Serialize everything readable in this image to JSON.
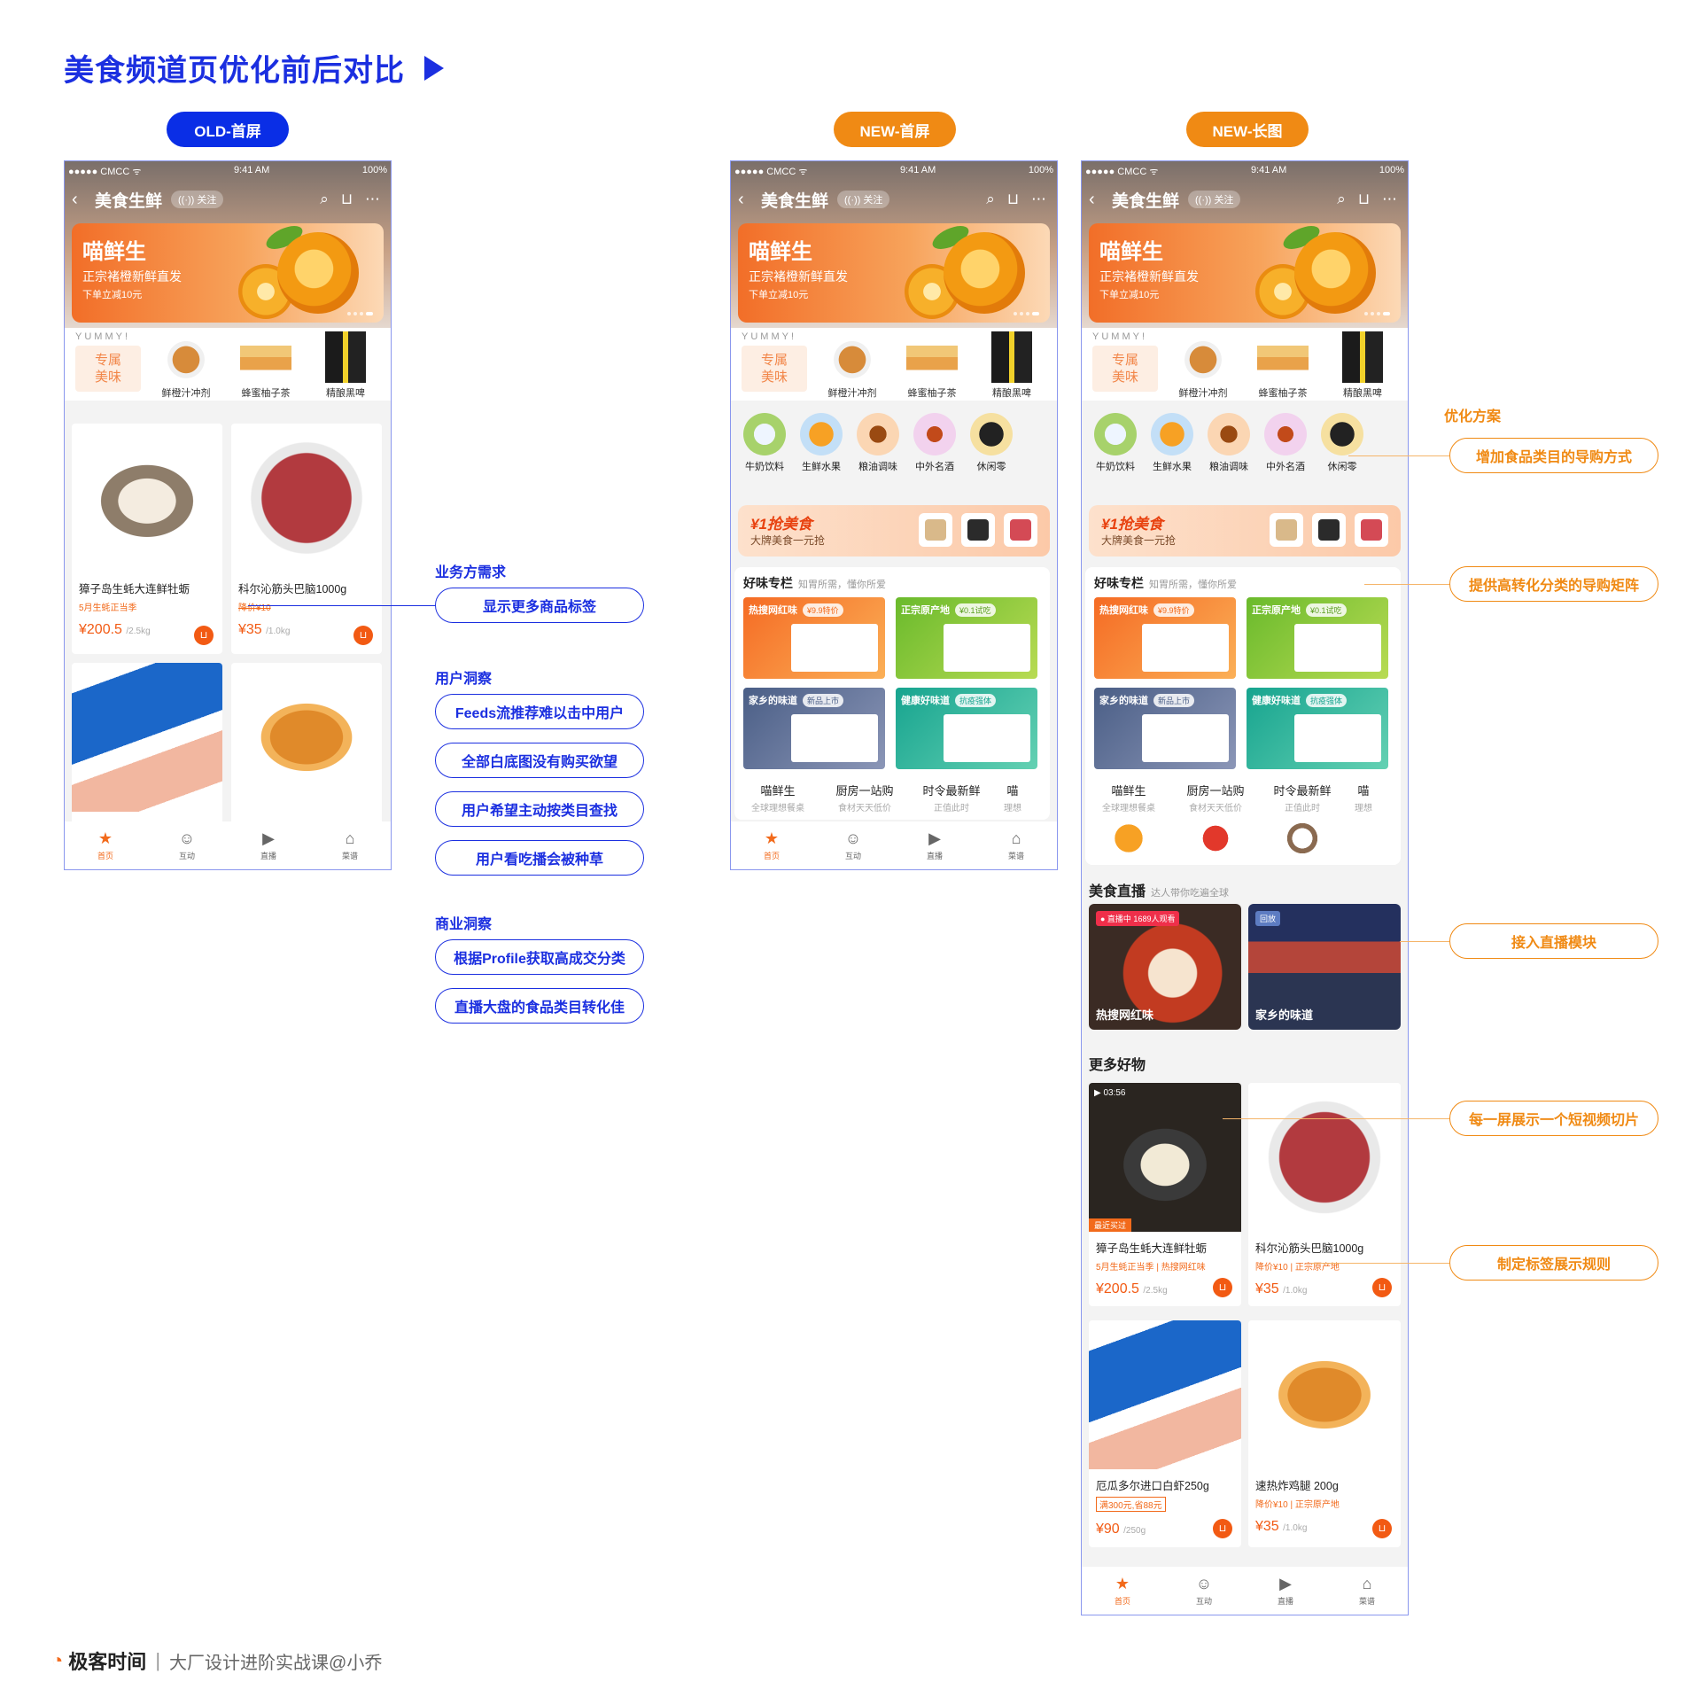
{
  "page": {
    "title": "美食频道页优化前后对比"
  },
  "labels": {
    "old": "OLD-首屏",
    "new_first": "NEW-首屏",
    "new_long": "NEW-长图"
  },
  "phone": {
    "status_left": "●●●●● CMCC ᯤ",
    "time": "9:41 AM",
    "battery": "100%",
    "back": "‹",
    "title": "美食生鲜",
    "follow": "((·)) 关注",
    "banner": {
      "title": "喵鲜生",
      "subtitle": "正宗褚橙新鲜直发",
      "promo": "下单立减10元"
    },
    "zone": {
      "yummy": "YUMMY!",
      "label": "专属\n美味",
      "items": [
        "鲜橙汁冲剂",
        "蜂蜜柚子茶",
        "精酿黑啤"
      ]
    },
    "categories": [
      "牛奶饮料",
      "生鲜水果",
      "粮油调味",
      "中外名酒",
      "休闲零"
    ],
    "grab": {
      "title": "¥1抢美食",
      "sub": "大牌美食一元抢"
    },
    "column": {
      "title": "好味专栏",
      "sub": "知胃所需，懂你所爱",
      "tiles": [
        {
          "name": "热搜网红味",
          "tag": "¥9.9特价"
        },
        {
          "name": "正宗原产地",
          "tag": "¥0.1试吃"
        },
        {
          "name": "家乡的味道",
          "tag": "新品上市"
        },
        {
          "name": "健康好味道",
          "tag": "抗疫强体"
        }
      ],
      "subs": [
        {
          "t": "喵鲜生",
          "s": "全球理想餐桌"
        },
        {
          "t": "厨房一站购",
          "s": "食材天天低价"
        },
        {
          "t": "时令最新鲜",
          "s": "正值此时"
        },
        {
          "t": "喵",
          "s": "理想"
        }
      ]
    },
    "tabs": [
      "首页",
      "互动",
      "直播",
      "菜谱"
    ],
    "tab_icons": [
      "★",
      "☺",
      "▶",
      "⌂"
    ],
    "live": {
      "title": "美食直播",
      "sub": "达人带你吃遍全球",
      "items": [
        {
          "badge": "● 直播中 1689人观看",
          "name": "热搜网红味"
        },
        {
          "badge": "回放",
          "name": "家乡的味道"
        }
      ]
    },
    "more": {
      "title": "更多好物"
    },
    "products_old": [
      {
        "name": "獐子岛生蚝大连鲜牡蛎",
        "tag": "5月生蚝正当季",
        "price": "¥200.5",
        "unit": "/2.5kg"
      },
      {
        "name": "科尔沁筋头巴脑1000g",
        "tag": "降价¥10",
        "price": "¥35",
        "unit": "/1.0kg"
      }
    ],
    "products_new": [
      {
        "name": "獐子岛生蚝大连鲜牡蛎",
        "tag": "5月生蚝正当季 | 热搜网红味",
        "price": "¥200.5",
        "unit": "/2.5kg",
        "video": "▶ 03:56",
        "recent": "最近买过"
      },
      {
        "name": "科尔沁筋头巴脑1000g",
        "tag": "降价¥10 | 正宗原产地",
        "price": "¥35",
        "unit": "/1.0kg"
      },
      {
        "name": "厄瓜多尔进口白虾250g",
        "tag": "满300元,省88元",
        "price": "¥90",
        "unit": "/250g"
      },
      {
        "name": "速热炸鸡腿 200g",
        "tag": "降价¥10 | 正宗原产地",
        "price": "¥35",
        "unit": "/1.0kg"
      }
    ]
  },
  "left_notes": {
    "biz_title": "业务方需求",
    "biz": [
      "显示更多商品标签"
    ],
    "user_title": "用户洞察",
    "user": [
      "Feeds流推荐难以击中用户",
      "全部白底图没有购买欲望",
      "用户希望主动按类目查找",
      "用户看吃播会被种草"
    ],
    "biz2_title": "商业洞察",
    "biz2": [
      "根据Profile获取高成交分类",
      "直播大盘的食品类目转化佳"
    ]
  },
  "right_notes": {
    "title": "优化方案",
    "items": [
      "增加食品类目的导购方式",
      "提供高转化分类的导购矩阵",
      "接入直播模块",
      "每一屏展示一个短视频切片",
      "制定标签展示规则"
    ]
  },
  "footer": {
    "brand": "极客时间",
    "sep": "|",
    "by": "大厂设计进阶实战课@小乔"
  },
  "colors": {
    "blue": "#1b2fe0",
    "orange": "#f08a14",
    "accent": "#f26a1b"
  }
}
